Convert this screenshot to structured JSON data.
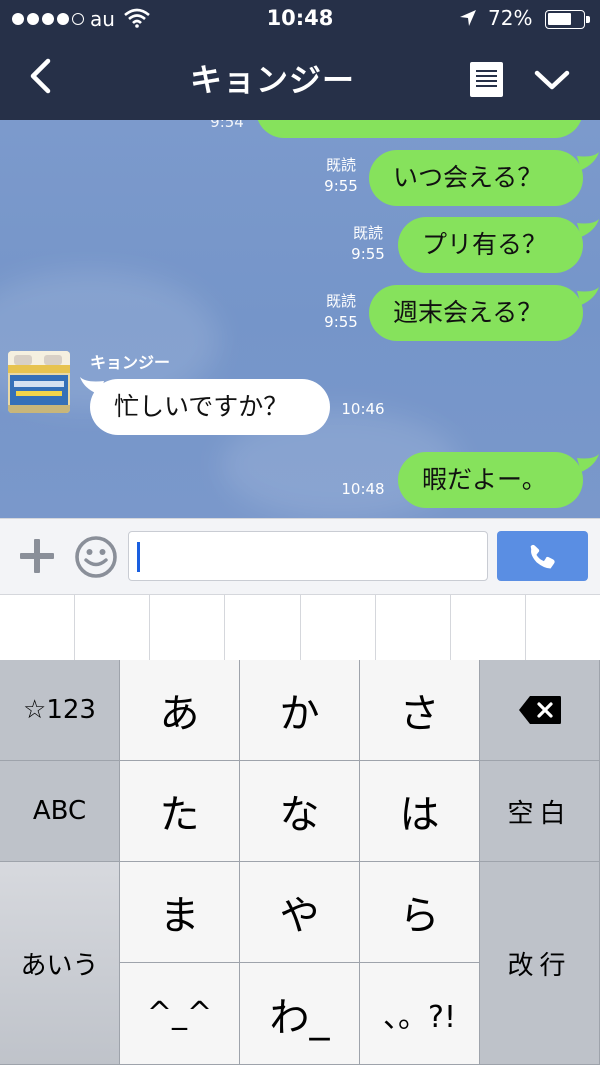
{
  "status_bar": {
    "carrier": "au",
    "time": "10:48",
    "battery": "72%",
    "battery_level": 0.72
  },
  "header": {
    "title": "キョンジー",
    "back_icon": "chevron-left-icon",
    "notes_icon": "note-icon",
    "more_icon": "chevron-down-icon"
  },
  "messages": [
    {
      "dir": "out",
      "text": "いつ会える？",
      "read": "既読",
      "time": "9:55"
    },
    {
      "dir": "out",
      "text": "プリ有る？",
      "read": "既読",
      "time": "9:55"
    },
    {
      "dir": "out",
      "text": "週末会える？",
      "read": "既読",
      "time": "9:55"
    },
    {
      "dir": "in",
      "sender": "キョンジー",
      "text": "忙しいですか？",
      "time": "10:46"
    },
    {
      "dir": "out",
      "text": "暇だよー。",
      "time": "10:48"
    }
  ],
  "composer": {
    "text": "",
    "plus_icon": "plus-icon",
    "emoji_icon": "smiley-icon",
    "call_icon": "phone-icon"
  },
  "keyboard": {
    "left": [
      "☆123",
      "ABC",
      "あいう"
    ],
    "rows": [
      [
        "あ",
        "か",
        "さ"
      ],
      [
        "た",
        "な",
        "は"
      ],
      [
        "ま",
        "や",
        "ら"
      ],
      [
        "^_^",
        "わ_",
        "、。?!"
      ]
    ],
    "right": [
      "delete",
      "空白",
      "改行"
    ],
    "delete_icon": "backspace-icon"
  },
  "colors": {
    "header": "#263048",
    "chat_background": "#7796ca",
    "outgoing_bubble": "#86e25c",
    "incoming_bubble": "#ffffff",
    "call_button": "#5a8ee3"
  }
}
